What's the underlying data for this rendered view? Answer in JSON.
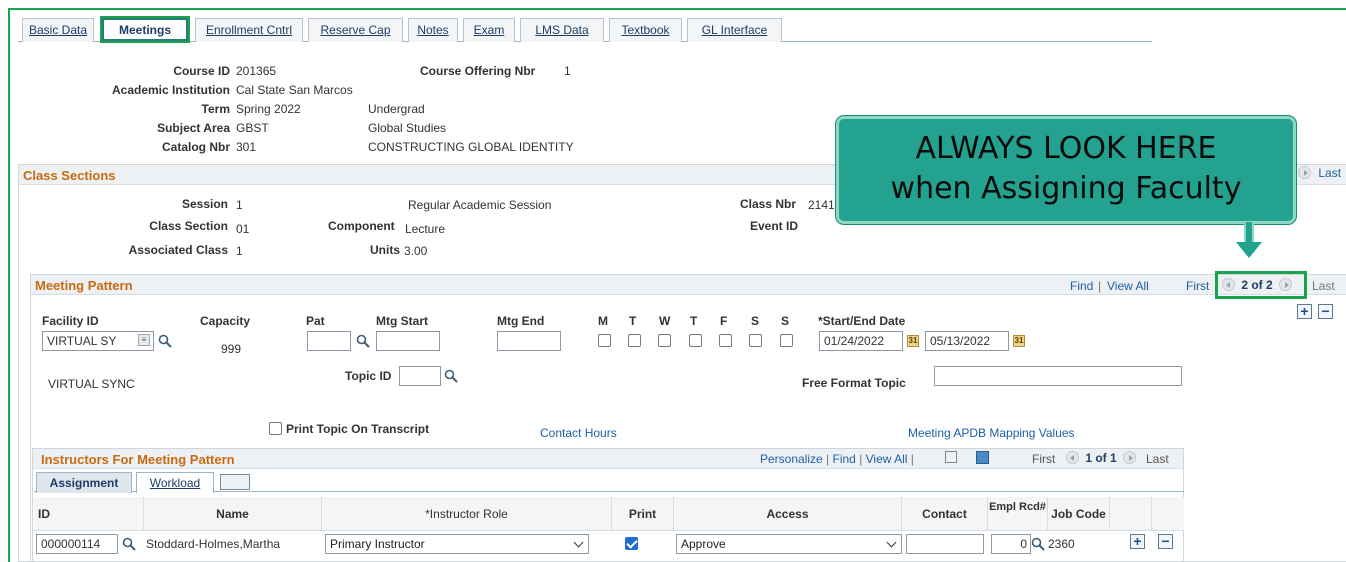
{
  "tabs": [
    "Basic Data",
    "Meetings",
    "Enrollment Cntrl",
    "Reserve Cap",
    "Notes",
    "Exam",
    "LMS Data",
    "Textbook",
    "GL Interface"
  ],
  "header": {
    "course_id_label": "Course ID",
    "course_id": "201365",
    "offering_label": "Course Offering Nbr",
    "offering_nbr": "1",
    "institution_label": "Academic Institution",
    "institution": "Cal State San Marcos",
    "term_label": "Term",
    "term": "Spring 2022",
    "career": "Undergrad",
    "subject_label": "Subject Area",
    "subject": "GBST",
    "subject_desc": "Global Studies",
    "catalog_label": "Catalog Nbr",
    "catalog": "301",
    "catalog_desc": "CONSTRUCTING GLOBAL IDENTITY"
  },
  "class_sections": {
    "title": "Class Sections",
    "last": "Last",
    "session_label": "Session",
    "session": "1",
    "session_desc": "Regular Academic Session",
    "class_nbr_label": "Class Nbr",
    "class_nbr": "2141",
    "section_label": "Class Section",
    "section": "01",
    "component_label": "Component",
    "component": "Lecture",
    "event_label": "Event ID",
    "assoc_label": "Associated Class",
    "assoc": "1",
    "units_label": "Units",
    "units": "3.00"
  },
  "meeting_pattern": {
    "title": "Meeting Pattern",
    "find": "Find",
    "view_all": "View All",
    "first": "First",
    "pager": "2 of 2",
    "last": "Last",
    "facility_label": "Facility ID",
    "facility": "VIRTUAL SY",
    "capacity_label": "Capacity",
    "capacity": "999",
    "pat_label": "Pat",
    "mtg_start_label": "Mtg Start",
    "mtg_end_label": "Mtg End",
    "days": [
      "M",
      "T",
      "W",
      "T",
      "F",
      "S",
      "S"
    ],
    "date_label": "*Start/End Date",
    "start_date": "01/24/2022",
    "end_date": "05/13/2022",
    "facility_desc": "VIRTUAL  SYNC",
    "topic_label": "Topic ID",
    "free_topic_label": "Free Format Topic",
    "print_topic_label": "Print Topic On Transcript",
    "contact_hours": "Contact Hours",
    "apdb": "Meeting APDB Mapping Values"
  },
  "instructors": {
    "title": "Instructors For Meeting Pattern",
    "personalize": "Personalize",
    "find": "Find",
    "view_all": "View All",
    "first": "First",
    "pager": "1 of 1",
    "last": "Last",
    "tab_assignment": "Assignment",
    "tab_workload": "Workload",
    "columns": [
      "ID",
      "Name",
      "*Instructor Role",
      "Print",
      "Access",
      "Contact",
      "Empl Rcd#",
      "Job Code"
    ],
    "row": {
      "id": "000000114",
      "name": "Stoddard-Holmes,Martha",
      "role": "Primary Instructor",
      "access": "Approve",
      "empl_rcd": "0",
      "job_code": "2360"
    }
  },
  "callout": {
    "line1": "ALWAYS LOOK HERE",
    "line2": "when Assigning Faculty"
  }
}
